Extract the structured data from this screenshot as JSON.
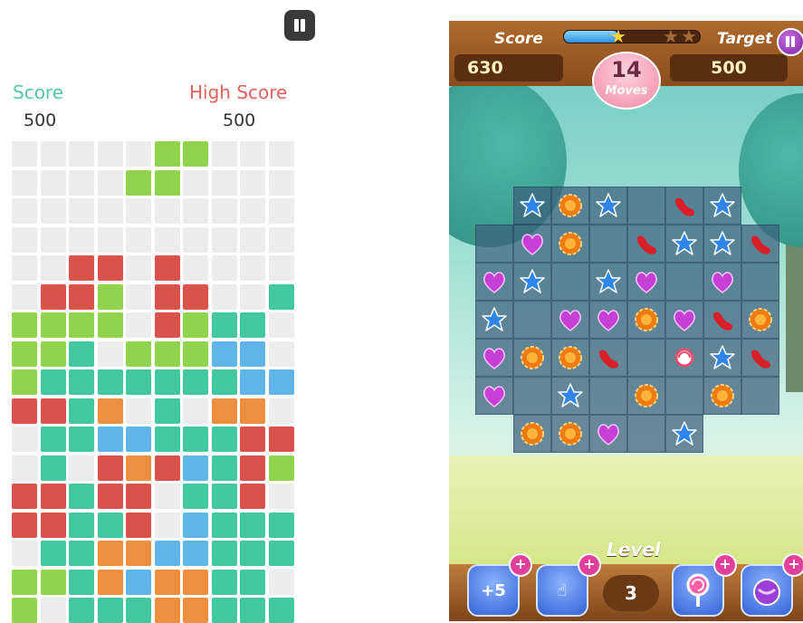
{
  "left_game": {
    "score_label": "Score",
    "score_value": "500",
    "high_score_label": "High Score",
    "high_score_value": "500",
    "colors": {
      "G": "#8fd44c",
      "R": "#d9534c",
      "T": "#43c7a0",
      "O": "#ee8f3f",
      "B": "#5fb5e8",
      "E": "#ececec"
    },
    "grid": [
      "EEEEEGGEEE",
      "EEEEGGEEEE",
      "EEEEEEEEEE",
      "EEEEEEEEEE",
      "EERREREEEE",
      "ERRGERREET",
      "GGGGERGTTE",
      "GGTEGGGBBE",
      "GTTTTTTTBB",
      "RRTOETEOOE",
      "ETTBBTTTRR",
      "ETERORBTRG",
      "RRTRRETTRE",
      "RRTTREBTTT",
      "ETTOOBBTTT",
      "GGTOBOOTTE",
      "GETTTOOTTT"
    ]
  },
  "right_game": {
    "score_label": "Score",
    "score_value": "630",
    "target_label": "Target",
    "target_value": "500",
    "moves_value": "14",
    "moves_label": "Moves",
    "progress": 0.4,
    "level_label": "Level",
    "level_value": "3",
    "booster_plus_value": "+5",
    "candy_colors": {
      "b": "#2f86e8",
      "o": "#f07a12",
      "p": "#c83fd8",
      "r": "#d81f2a",
      "w": "#e85070"
    },
    "board": [
      "_bob_rb_",
      "_po_rbbr",
      "pb_bp_p_",
      "b_ppopro",
      "poor_wbr",
      "p_b_o_o_",
      "_oop_b__"
    ]
  }
}
